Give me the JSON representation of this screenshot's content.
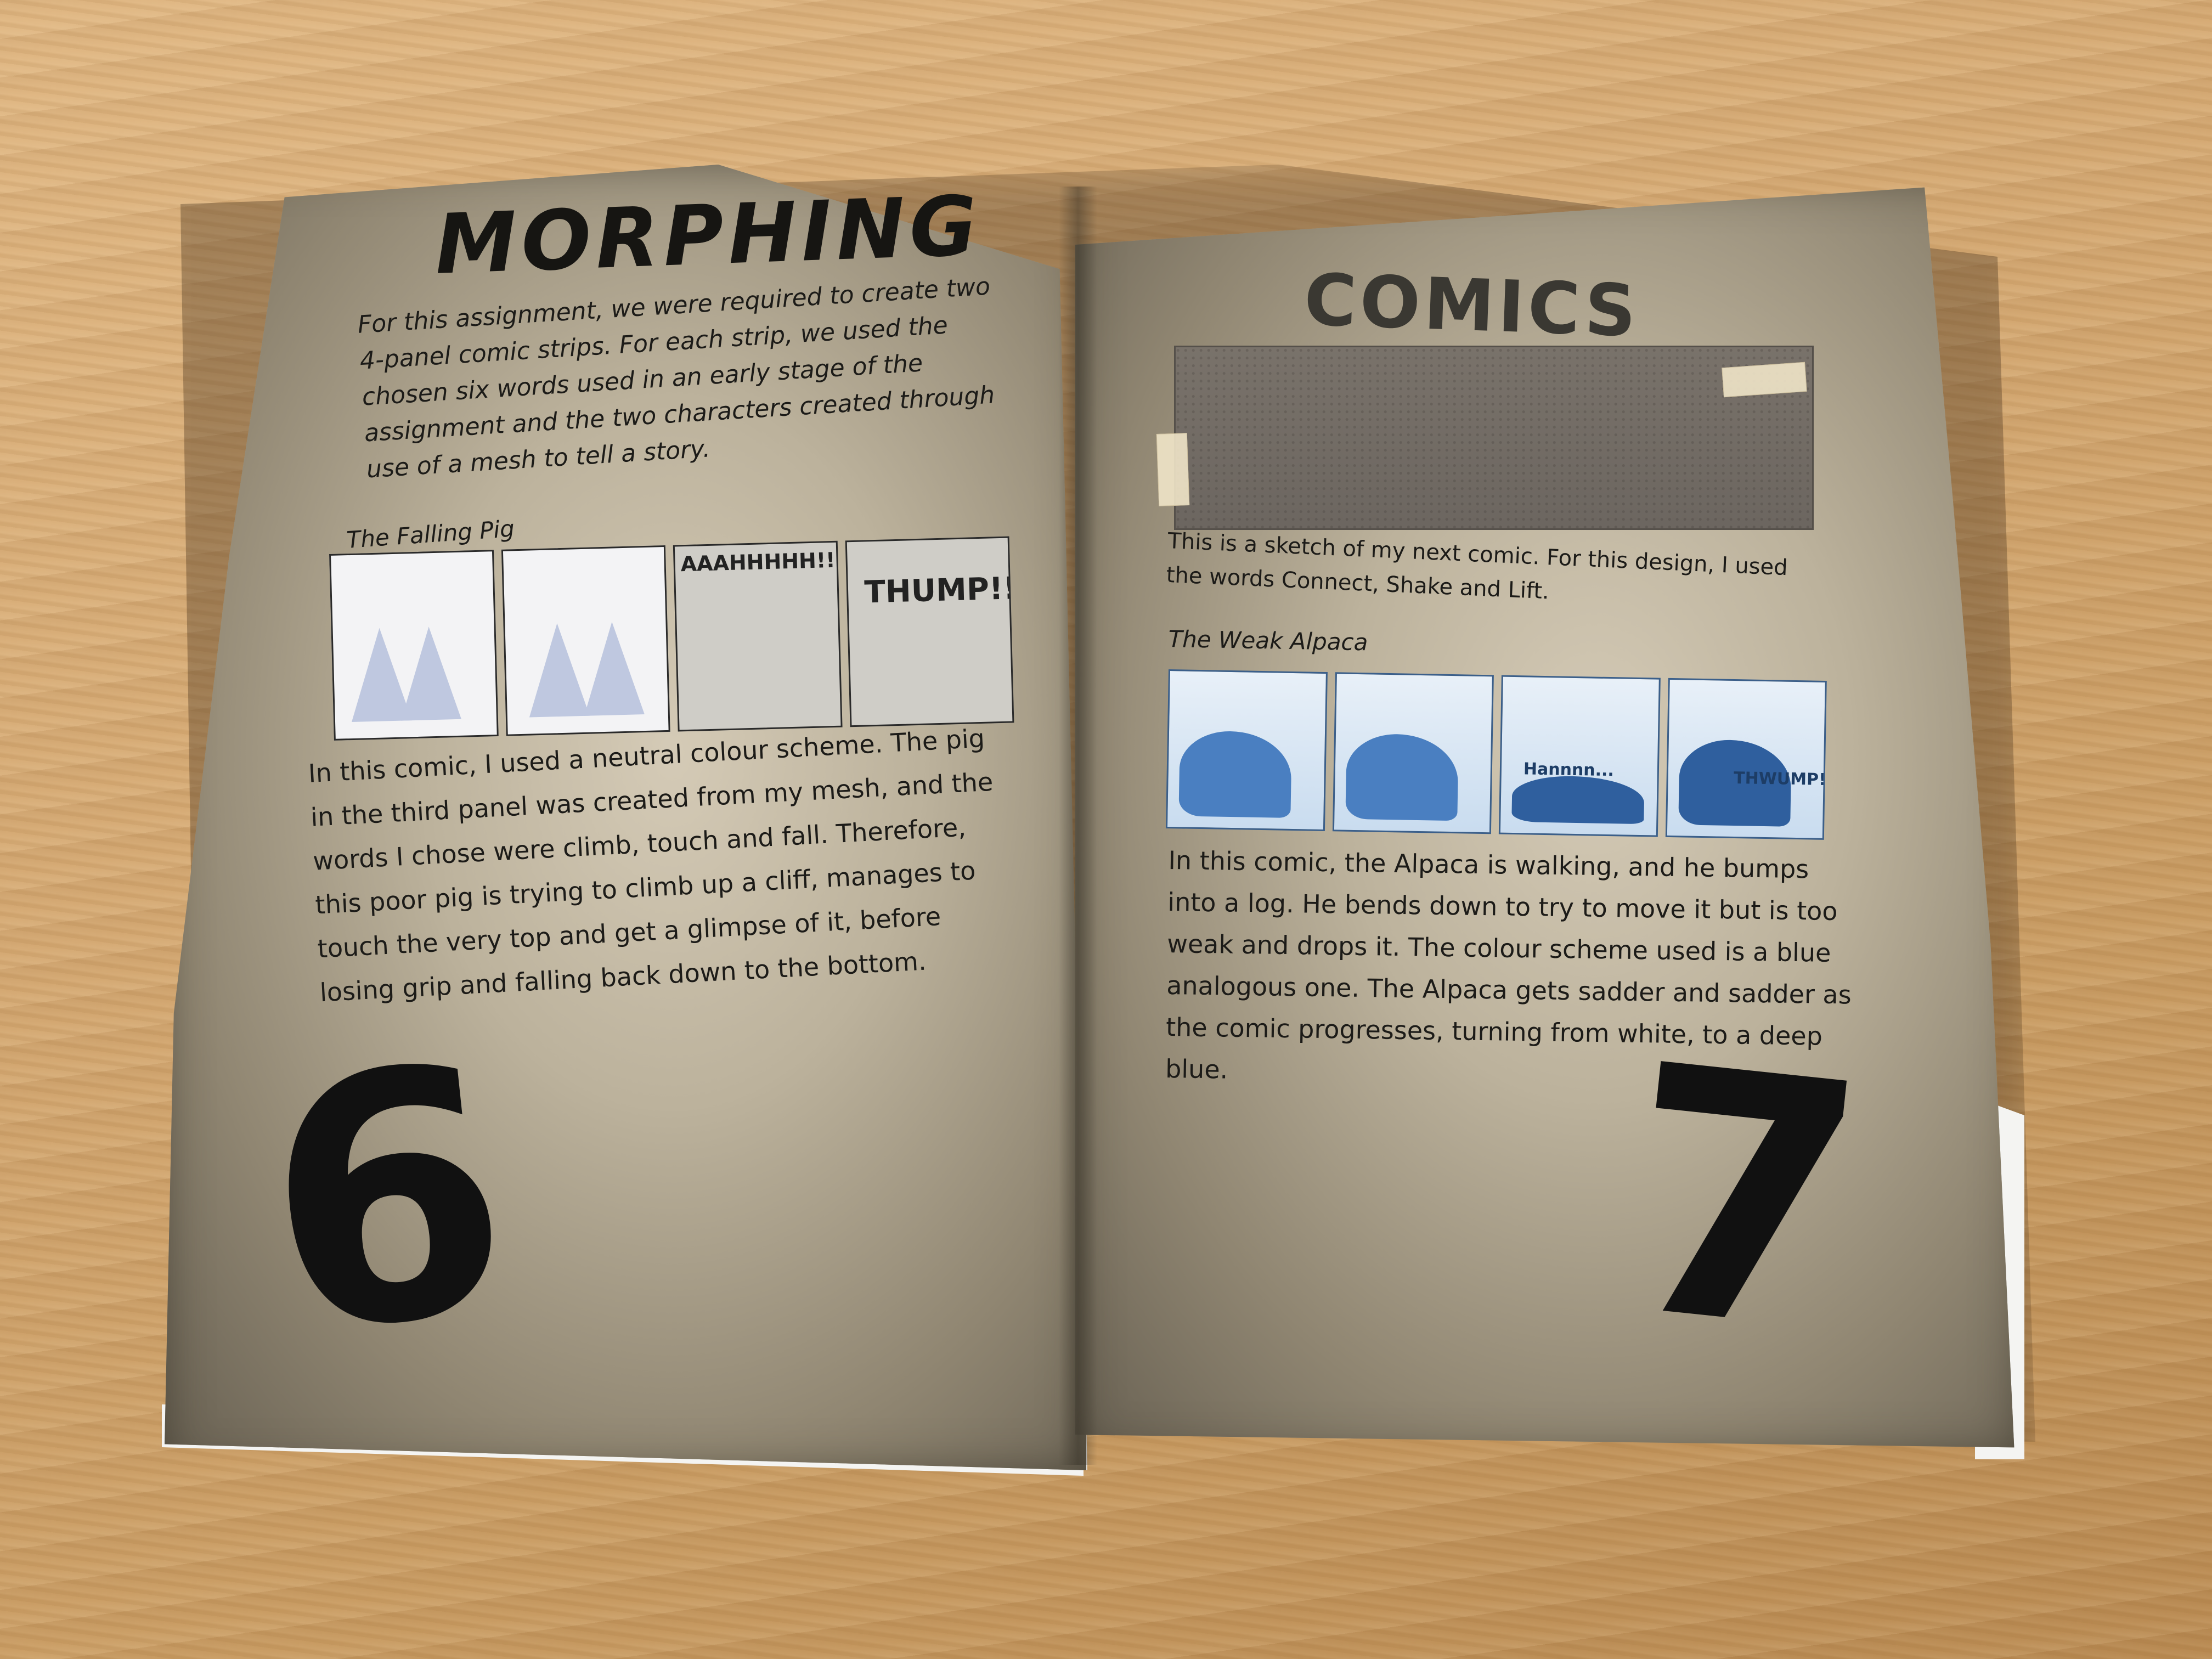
{
  "left_page": {
    "title": "MORPHING",
    "intro": "For this assignment, we were required to create two 4-panel comic strips. For each strip, we used the chosen six words used in an early stage of the assignment and the two characters created through use of a mesh to tell a story.",
    "comic_caption": "The Falling Pig",
    "panels": [
      {
        "sfx": ""
      },
      {
        "sfx": ""
      },
      {
        "sfx": "AAAHHHHH!!!!"
      },
      {
        "sfx": "THUMP!!"
      }
    ],
    "body": "In this comic, I used a neutral colour scheme. The pig in the third panel was created from my mesh, and the words I chose were climb, touch and fall. Therefore, this poor pig is trying to climb up a cliff, manages to touch the very top and get a glimpse of it, before losing grip and falling back down to the bottom.",
    "page_number": "6"
  },
  "right_page": {
    "title": "COMICS",
    "sketch_note": "This is a sketch of my next comic. For this design, I used the words Connect, Shake and Lift.",
    "comic_caption": "The Weak Alpaca",
    "panels": [
      {
        "sfx": ""
      },
      {
        "sfx": ""
      },
      {
        "sfx": "Hannnn..."
      },
      {
        "sfx": "THWUMP!"
      }
    ],
    "body": "In this comic, the Alpaca is walking, and he bumps into a log. He bends down to try to move it but is too weak and drops it. The colour scheme used is a blue analogous one. The Alpaca gets sadder and sadder as the comic progresses, turning from white, to a deep blue.",
    "page_number": "7"
  },
  "colors": {
    "table": "#d4a872",
    "page": "#a89e88",
    "ink": "#1c1b18",
    "alpaca_blue": "#4a7fc1"
  }
}
